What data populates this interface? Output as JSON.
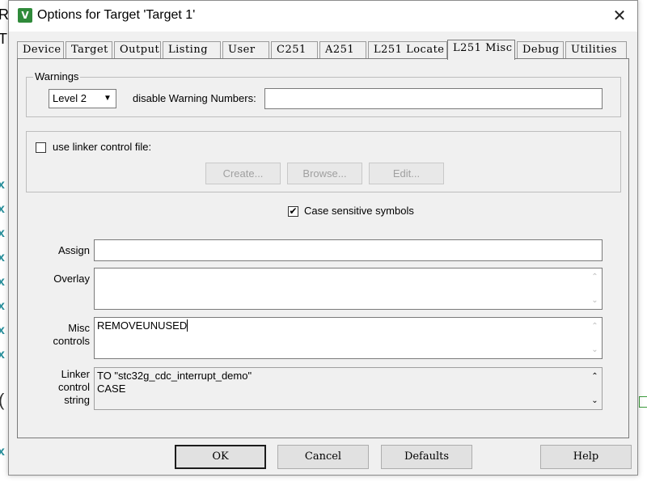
{
  "background": {
    "fragment_r": "R",
    "fragment_t": "T",
    "x_mark": "x",
    "paren": "("
  },
  "dialog": {
    "title": "Options for Target 'Target 1'",
    "app_icon": "V",
    "close_glyph": "✕"
  },
  "tabs": [
    {
      "label": "Device"
    },
    {
      "label": "Target"
    },
    {
      "label": "Output"
    },
    {
      "label": "Listing"
    },
    {
      "label": "User"
    },
    {
      "label": "C251"
    },
    {
      "label": "A251"
    },
    {
      "label": "L251 Locate"
    },
    {
      "label": "L251 Misc"
    },
    {
      "label": "Debug"
    },
    {
      "label": "Utilities"
    }
  ],
  "active_tab": "L251 Misc",
  "warnings": {
    "group_label": "Warnings",
    "level_value": "Level 2",
    "disable_label": "disable Warning Numbers:",
    "disable_value": ""
  },
  "linker_file": {
    "checkbox_label": "use linker control file:",
    "checked": false,
    "create_label": "Create...",
    "browse_label": "Browse...",
    "edit_label": "Edit..."
  },
  "case_sensitive": {
    "label": "Case sensitive symbols",
    "checked": true,
    "check_glyph": "✔"
  },
  "assign": {
    "label": "Assign",
    "value": ""
  },
  "overlay": {
    "label": "Overlay",
    "value": ""
  },
  "misc": {
    "label_line1": "Misc",
    "label_line2": "controls",
    "value": "REMOVEUNUSED"
  },
  "linker_string": {
    "label_line1": "Linker",
    "label_line2": "control",
    "label_line3": "string",
    "value": "TO \"stc32g_cdc_interrupt_demo\"\nCASE"
  },
  "icons": {
    "dropdown": "▼",
    "scroll_up": "⌃",
    "scroll_down": "⌄"
  },
  "buttons": {
    "ok": "OK",
    "cancel": "Cancel",
    "defaults": "Defaults",
    "help": "Help"
  }
}
